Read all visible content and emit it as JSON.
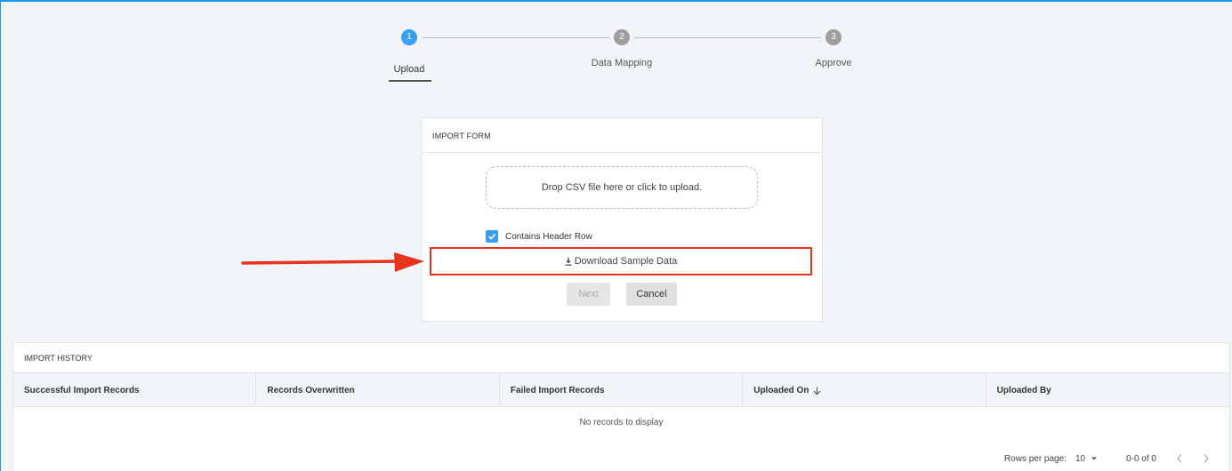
{
  "stepper": {
    "steps": [
      {
        "number": "1",
        "label": "Upload",
        "state": "active"
      },
      {
        "number": "2",
        "label": "Data Mapping",
        "state": "inactive"
      },
      {
        "number": "3",
        "label": "Approve",
        "state": "inactive"
      }
    ]
  },
  "import_form": {
    "title": "IMPORT FORM",
    "dropzone_text": "Drop CSV file here or click to upload.",
    "header_row_label": "Contains Header Row",
    "header_row_checked": true,
    "download_label": "Download Sample Data",
    "next_label": "Next",
    "cancel_label": "Cancel"
  },
  "history": {
    "title": "IMPORT HISTORY",
    "columns": [
      "Successful Import Records",
      "Records Overwritten",
      "Failed Import Records",
      "Uploaded On",
      "Uploaded By"
    ],
    "sorted_column": "Uploaded On",
    "empty_text": "No records to display",
    "rows_per_page_label": "Rows per page:",
    "rows_per_page_value": "10",
    "range_text": "0-0 of 0"
  },
  "colors": {
    "accent": "#3a9ff2",
    "highlight": "#e8341c",
    "background": "#f1f4f8"
  }
}
